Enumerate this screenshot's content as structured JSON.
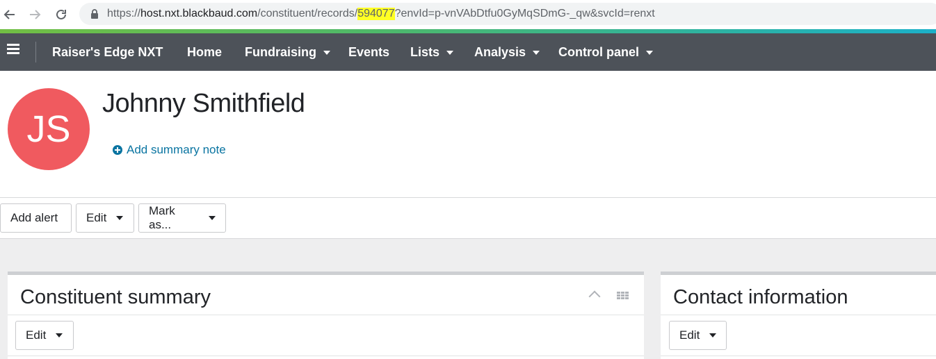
{
  "browser": {
    "url_prefix": "https://",
    "url_host": "host.nxt.blackbaud.com",
    "url_path_before": "/constituent/records/",
    "url_highlight": "594077",
    "url_path_after": "?envId=p-vnVAbDtfu0GyMqSDmG-_qw&svcId=renxt",
    "icons": [
      "back-arrow-icon",
      "forward-arrow-icon",
      "reload-icon",
      "lock-icon"
    ]
  },
  "nav": {
    "brand": "Raiser's Edge NXT",
    "items": [
      {
        "label": "Home",
        "dropdown": false
      },
      {
        "label": "Fundraising",
        "dropdown": true
      },
      {
        "label": "Events",
        "dropdown": false
      },
      {
        "label": "Lists",
        "dropdown": true
      },
      {
        "label": "Analysis",
        "dropdown": true
      },
      {
        "label": "Control panel",
        "dropdown": true
      }
    ],
    "background": "#4d5259"
  },
  "record": {
    "initials": "JS",
    "avatar_color": "#f05a5f",
    "name": "Johnny Smithfield",
    "add_note": "Add summary note"
  },
  "toolbar": {
    "add_alert": "Add alert",
    "edit": "Edit",
    "mark_as": "Mark as..."
  },
  "tiles": {
    "summary": {
      "title": "Constituent summary",
      "edit": "Edit"
    },
    "contact": {
      "title": "Contact information",
      "edit": "Edit"
    }
  }
}
